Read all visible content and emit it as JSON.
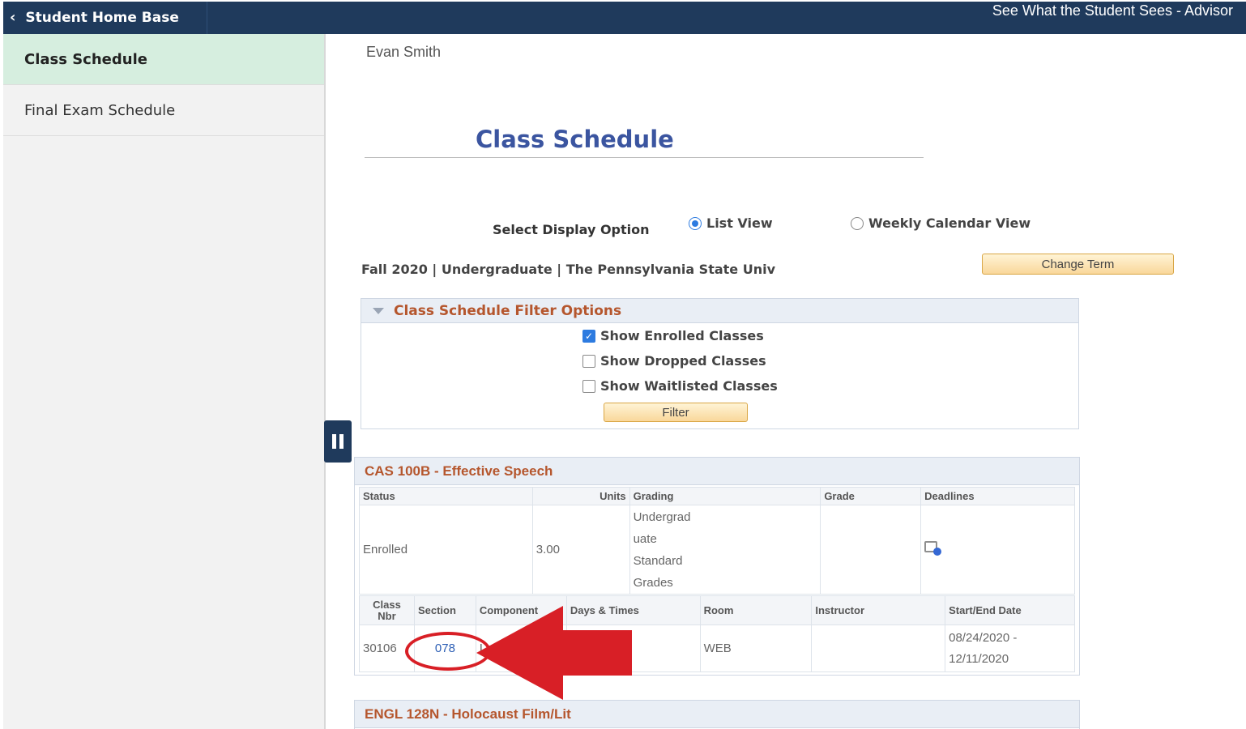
{
  "topbar": {
    "home_label": "Student Home Base",
    "right_text": "See What the Student Sees - Advisor"
  },
  "sidebar": {
    "items": [
      {
        "label": "Class Schedule",
        "active": true
      },
      {
        "label": "Final Exam Schedule",
        "active": false
      }
    ]
  },
  "main": {
    "student_name": "Evan Smith",
    "title": "Class Schedule",
    "display_option_label": "Select Display Option",
    "options": {
      "list": "List View",
      "weekly": "Weekly Calendar View",
      "selected": "List View"
    },
    "term_line": "Fall 2020 | Undergraduate | The Pennsylvania State Univ",
    "change_term_label": "Change Term"
  },
  "filter": {
    "title": "Class Schedule Filter Options",
    "options": [
      {
        "label": "Show Enrolled Classes",
        "checked": true
      },
      {
        "label": "Show Dropped Classes",
        "checked": false
      },
      {
        "label": "Show Waitlisted Classes",
        "checked": false
      }
    ],
    "button_label": "Filter"
  },
  "courses": [
    {
      "title": "CAS 100B - Effective Speech",
      "status_headers": [
        "Status",
        "Units",
        "Grading",
        "Grade",
        "Deadlines"
      ],
      "status_row": {
        "status": "Enrolled",
        "units": "3.00",
        "grading_lines": [
          "Undergrad",
          "uate",
          "Standard",
          "Grades"
        ],
        "grade": ""
      },
      "class_headers": [
        "Class Nbr",
        "Section",
        "Component",
        "Days & Times",
        "Room",
        "Instructor",
        "Start/End Date"
      ],
      "class_row": {
        "class_nbr": "30106",
        "section": "078",
        "component": "Lec",
        "days_times": "",
        "room": "WEB",
        "instructor": "",
        "start_date": "08/24/2020 -",
        "end_date": "12/11/2020"
      }
    },
    {
      "title": "ENGL 128N - Holocaust Film/Lit"
    }
  ],
  "annotation": {
    "highlight_color": "#d81f26"
  }
}
